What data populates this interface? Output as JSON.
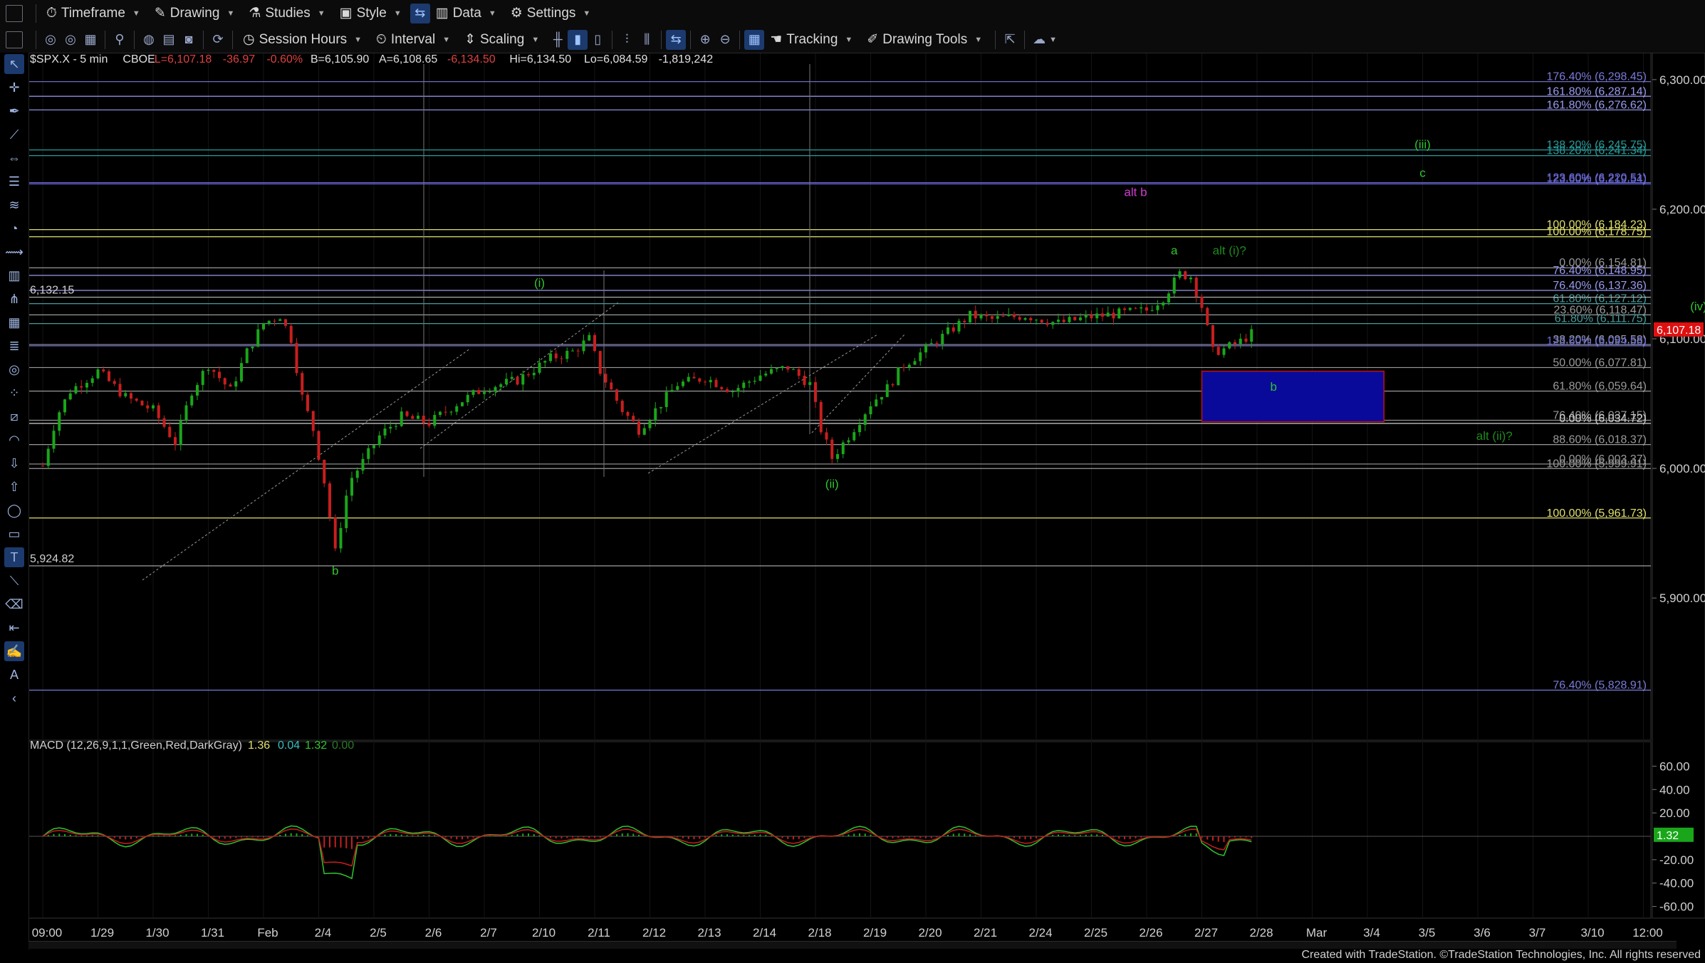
{
  "toolbar1": {
    "timeframe": "Timeframe",
    "drawing": "Drawing",
    "studies": "Studies",
    "style": "Style",
    "data": "Data",
    "settings": "Settings"
  },
  "toolbar2": {
    "session_hours": "Session Hours",
    "interval": "Interval",
    "scaling": "Scaling",
    "tracking": "Tracking",
    "drawing_tools": "Drawing Tools"
  },
  "symbol_header": {
    "symbol": "$SPX.X - 5 min",
    "exchange": "CBOE",
    "last": "L=6,107.18",
    "change": "-36.97",
    "change_pct": "-0.60%",
    "bid": "B=6,105.90",
    "ask": "A=6,108.65",
    "open": "-6,134.50",
    "high": "Hi=6,134.50",
    "low": "Lo=6,084.59",
    "volume": "-1,819,242"
  },
  "macd_header": {
    "label": "MACD (12,26,9,1,1,Green,Red,DarkGray)",
    "v1": "1.36",
    "v2": "0.04",
    "v3": "1.32",
    "v4": "0.00"
  },
  "footer": "Created with TradeStation. ©TradeStation Technologies, Inc. All rights reserved",
  "colors": {
    "background": "#000000",
    "up_candle": "#1aa61a",
    "down_candle": "#c81e1e",
    "wave_green": "#2fc52f",
    "alt_magenta": "#d23ad2",
    "box_blue": "#0a0a9a",
    "fib_yellow": "#e0e070",
    "fib_blue": "#6a6ad8",
    "fib_teal": "#3a8a8a",
    "last_price_red": "#e01010"
  },
  "chart_data": {
    "type": "candlestick",
    "main": {
      "ylim": [
        5793,
        6312
      ],
      "y_ticks": [
        "6,300.00",
        "6,200.00",
        "6,100.00",
        "6,000.00",
        "5,900.00"
      ],
      "y_tick_values": [
        6300,
        6200,
        6100,
        6000,
        5900
      ],
      "last_price": "6,107.18",
      "last_price_value": 6107.18,
      "x_ticks": [
        "09:00",
        "1/29",
        "1/30",
        "1/31",
        "Feb",
        "2/4",
        "2/5",
        "2/6",
        "2/7",
        "2/10",
        "2/11",
        "2/12",
        "2/13",
        "2/14",
        "2/18",
        "2/19",
        "2/20",
        "2/21",
        "2/24",
        "2/25",
        "2/26",
        "2/27",
        "2/28",
        "Mar",
        "3/4",
        "3/5",
        "3/6",
        "3/7",
        "3/10",
        "12:00"
      ],
      "price_path": [
        [
          0,
          6002
        ],
        [
          0.25,
          6040
        ],
        [
          0.5,
          6060
        ],
        [
          1,
          6075
        ],
        [
          1.5,
          6055
        ],
        [
          2,
          6045
        ],
        [
          2.4,
          6020
        ],
        [
          2.7,
          6060
        ],
        [
          3,
          6080
        ],
        [
          3.4,
          6060
        ],
        [
          3.7,
          6090
        ],
        [
          4,
          6112
        ],
        [
          4.3,
          6118
        ],
        [
          4.5,
          6100
        ],
        [
          4.7,
          6055
        ],
        [
          4.9,
          6030
        ],
        [
          5.1,
          5990
        ],
        [
          5.3,
          5935
        ],
        [
          5.55,
          5990
        ],
        [
          5.8,
          6005
        ],
        [
          6.1,
          6025
        ],
        [
          6.5,
          6040
        ],
        [
          7,
          6035
        ],
        [
          7.5,
          6050
        ],
        [
          8,
          6062
        ],
        [
          8.6,
          6068
        ],
        [
          9.2,
          6085
        ],
        [
          9.6,
          6090
        ],
        [
          9.9,
          6100
        ],
        [
          10.1,
          6075
        ],
        [
          10.5,
          6045
        ],
        [
          10.8,
          6030
        ],
        [
          11.1,
          6045
        ],
        [
          11.5,
          6065
        ],
        [
          12,
          6070
        ],
        [
          12.5,
          6060
        ],
        [
          13,
          6072
        ],
        [
          13.5,
          6078
        ],
        [
          13.9,
          6065
        ],
        [
          14.1,
          6030
        ],
        [
          14.3,
          6008
        ],
        [
          14.6,
          6025
        ],
        [
          15,
          6050
        ],
        [
          15.3,
          6062
        ],
        [
          15.6,
          6080
        ],
        [
          16,
          6092
        ],
        [
          16.4,
          6105
        ],
        [
          16.8,
          6118
        ],
        [
          17.2,
          6115
        ],
        [
          17.8,
          6118
        ],
        [
          18.4,
          6112
        ],
        [
          19,
          6117
        ],
        [
          19.6,
          6120
        ],
        [
          20,
          6122
        ],
        [
          20.3,
          6132
        ],
        [
          20.6,
          6150
        ],
        [
          20.8,
          6148
        ],
        [
          21,
          6125
        ],
        [
          21.2,
          6090
        ],
        [
          21.4,
          6092
        ],
        [
          21.7,
          6098
        ],
        [
          22,
          6107
        ]
      ],
      "x_data_extent": [
        0,
        29
      ],
      "horizontal_levels": [
        {
          "label": "176.40% (6,298.45)",
          "value": 6298.45,
          "color": "#7a7ad8"
        },
        {
          "label": "161.80% (6,287.14)",
          "value": 6287.14,
          "color": "#9a9af0"
        },
        {
          "label": "161.80% (6,276.62)",
          "value": 6276.62,
          "color": "#9a9af0"
        },
        {
          "label": "138.20% (6,245.75)",
          "value": 6245.75,
          "color": "#2a9a9a"
        },
        {
          "label": "138.20% (6,241.34)",
          "value": 6241.34,
          "color": "#2a9a9a"
        },
        {
          "label": "123.60% (6,220.51)",
          "value": 6220.51,
          "color": "#6a6ad8"
        },
        {
          "label": "123.60% (6,219.54)",
          "value": 6219.54,
          "color": "#6a6ad8"
        },
        {
          "label": "100.00% (6,184.23)",
          "value": 6184.23,
          "color": "#e0e070"
        },
        {
          "label": "100.00% (6,178.75)",
          "value": 6178.75,
          "color": "#e0e070"
        },
        {
          "label": "0.00% (6,154.81)",
          "value": 6154.81,
          "color": "#9a9a9a"
        },
        {
          "label": "76.40% (6,148.95)",
          "value": 6148.95,
          "color": "#9a9af0"
        },
        {
          "label": "76.40% (6,137.36)",
          "value": 6137.36,
          "color": "#9a9af0"
        },
        {
          "label": "61.80% (6,127.12)",
          "value": 6127.12,
          "color": "#4a9a9a"
        },
        {
          "label": "23.60% (6,118.47)",
          "value": 6118.47,
          "color": "#9a9a9a"
        },
        {
          "label": "61.80% (6,111.75)",
          "value": 6111.75,
          "color": "#4a9a9a"
        },
        {
          "label": "38.20% (6,095.58)",
          "value": 6095.58,
          "color": "#9a9a9a"
        },
        {
          "label": "123.60% (6,094.58)",
          "value": 6094.58,
          "color": "#6a6ad8"
        },
        {
          "label": "50.00% (6,077.81)",
          "value": 6077.81,
          "color": "#9a9a9a"
        },
        {
          "label": "61.80% (6,059.64)",
          "value": 6059.64,
          "color": "#9a9a9a"
        },
        {
          "label": "76.40% (6,037.15)",
          "value": 6037.15,
          "color": "#9a9a9a"
        },
        {
          "label": "0.00% (6,034.72)",
          "value": 6034.72,
          "color": "#d0d0d0"
        },
        {
          "label": "88.60% (6,018.37)",
          "value": 6018.37,
          "color": "#9a9a9a"
        },
        {
          "label": "0.00% (6,003.37)",
          "value": 6003.37,
          "color": "#9a9a9a"
        },
        {
          "label": "100.00% (5,999.91)",
          "value": 5999.91,
          "color": "#9a9a9a"
        },
        {
          "label": "100.00% (5,961.73)",
          "value": 5961.73,
          "color": "#e0e070"
        },
        {
          "label": "76.40% (5,828.91)",
          "value": 5828.91,
          "color": "#7a7ad8"
        }
      ],
      "left_level_labels": [
        {
          "label": "6,132.15",
          "value": 6132.15
        },
        {
          "label": "5,924.82",
          "value": 5924.82
        }
      ],
      "wave_labels": [
        {
          "text": "(i)",
          "x": 9.0,
          "y": 6140,
          "color": "#2fc52f"
        },
        {
          "text": "(ii)",
          "x": 14.3,
          "y": 5985,
          "color": "#2fc52f"
        },
        {
          "text": "b",
          "x": 5.3,
          "y": 5918,
          "color": "#2fc52f"
        },
        {
          "text": "a",
          "x": 20.5,
          "y": 6165,
          "color": "#2fc52f"
        },
        {
          "text": "alt (i)?",
          "x": 21.5,
          "y": 6165,
          "color": "#1d8a1d"
        },
        {
          "text": "alt b",
          "x": 19.8,
          "y": 6210,
          "color": "#d23ad2"
        },
        {
          "text": "(iii)",
          "x": 25.0,
          "y": 6247,
          "color": "#2fc52f"
        },
        {
          "text": "c",
          "x": 25.0,
          "y": 6225,
          "color": "#2fc52f"
        },
        {
          "text": "(iv)",
          "x": 30.0,
          "y": 6122,
          "color": "#2fc52f"
        },
        {
          "text": "b",
          "x": 22.3,
          "y": 6060,
          "color": "#2fc52f"
        },
        {
          "text": "alt (ii)?",
          "x": 26.3,
          "y": 6022,
          "color": "#1d8a1d"
        }
      ],
      "target_box": {
        "x0": 21.0,
        "x1": 24.3,
        "y0": 6036,
        "y1": 6075
      }
    },
    "macd": {
      "ylim": [
        -70,
        70
      ],
      "y_ticks": [
        "60.00",
        "40.00",
        "20.00",
        "-20.00",
        "-40.00",
        "-60.00"
      ],
      "y_tick_values": [
        60,
        40,
        20,
        -20,
        -40,
        -60
      ],
      "current": "1.32",
      "current_value": 1.32
    }
  }
}
